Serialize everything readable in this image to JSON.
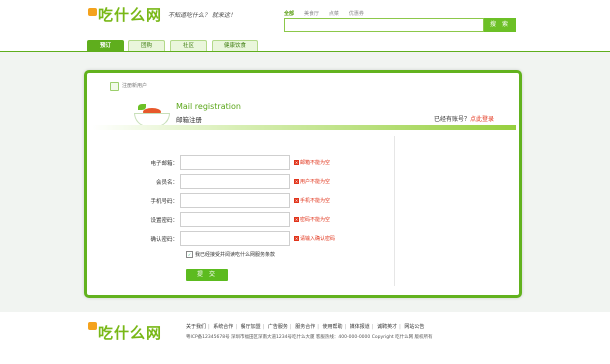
{
  "header": {
    "logo_text": "吃什么网",
    "slogan": "不知道吃什么？ 就来这！",
    "search_tabs": [
      "全部",
      "美食厅",
      "点菜",
      "优惠券"
    ],
    "search_placeholder": "",
    "search_button": "搜 索"
  },
  "nav": {
    "tabs": [
      "预订",
      "团购",
      "社区",
      "健康饮食"
    ]
  },
  "breadcrumb": "注册新用户",
  "registration": {
    "title_en": "Mail registration",
    "title_cn": "邮箱注册",
    "already_text": "已经有账号？",
    "login_link": "点此登录"
  },
  "form": {
    "fields": [
      {
        "label": "电子邮箱：",
        "error": "邮箱不能为空"
      },
      {
        "label": "会员名：",
        "error": "用户不能为空"
      },
      {
        "label": "手机号码：",
        "error": "手机不能为空"
      },
      {
        "label": "设置密码：",
        "error": "密码不能为空"
      },
      {
        "label": "确认密码：",
        "error": "请输入确认密码"
      }
    ],
    "agree_text": "我已经接受并阅读吃什么网服务条款",
    "submit_label": "提 交"
  },
  "footer": {
    "logo_text": "吃什么网",
    "links": [
      "关于我们",
      "系统合作",
      "餐厅加盟",
      "广告服务",
      "服务合作",
      "使用帮助",
      "媒体报道",
      "诚聘英才",
      "网站公告"
    ],
    "address": "粤ICP备12345678号  深圳市福田区深南大道1234号吃什么大厦  客服热线：400-000-0000  Copyright 吃什么网 版权所有"
  },
  "colors": {
    "brand_green": "#62b21e",
    "error_red": "#e1341b",
    "logo_orange": "#f4a21d"
  }
}
